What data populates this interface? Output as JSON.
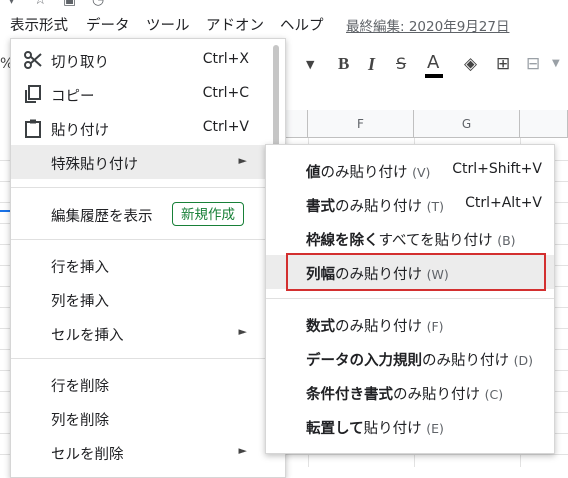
{
  "menubar": {
    "items": [
      "表示形式",
      "データ",
      "ツール",
      "アドオン",
      "ヘルプ"
    ],
    "last_edit": "最終編集: 2020年9月27日"
  },
  "toolbar": {
    "percent": "%",
    "bold": "B",
    "italic": "I",
    "strike": "S",
    "text_color": "A"
  },
  "grid": {
    "columns": [
      "F",
      "G"
    ]
  },
  "context_menu": {
    "cut": {
      "label": "切り取り",
      "shortcut": "Ctrl+X"
    },
    "copy": {
      "label": "コピー",
      "shortcut": "Ctrl+C"
    },
    "paste": {
      "label": "貼り付け",
      "shortcut": "Ctrl+V"
    },
    "paste_special": {
      "label": "特殊貼り付け",
      "arrow": "►"
    },
    "edit_history": {
      "label": "編集履歴を表示",
      "badge": "新規作成"
    },
    "insert_row": {
      "label": "行を挿入"
    },
    "insert_column": {
      "label": "列を挿入"
    },
    "insert_cells": {
      "label": "セルを挿入",
      "arrow": "►"
    },
    "delete_row": {
      "label": "行を削除"
    },
    "delete_column": {
      "label": "列を削除"
    },
    "delete_cells": {
      "label": "セルを削除",
      "arrow": "►"
    }
  },
  "paste_special_menu": {
    "values_only": {
      "bold": "値",
      "rest": "のみ貼り付け",
      "accel": "(V)",
      "shortcut": "Ctrl+Shift+V"
    },
    "format_only": {
      "bold": "書式",
      "rest": "のみ貼り付け",
      "accel": "(T)",
      "shortcut": "Ctrl+Alt+V"
    },
    "no_borders": {
      "bold": "枠線を除く",
      "rest": "すべてを貼り付け",
      "accel": "(B)"
    },
    "column_width": {
      "bold": "列幅",
      "rest": "のみ貼り付け",
      "accel": "(W)"
    },
    "formula_only": {
      "bold": "数式",
      "rest": "のみ貼り付け",
      "accel": "(F)"
    },
    "data_validation": {
      "bold": "データの入力規則",
      "rest": "のみ貼り付け",
      "accel": "(D)"
    },
    "conditional_format": {
      "bold": "条件付き書式",
      "rest": "のみ貼り付け",
      "accel": "(C)"
    },
    "transpose": {
      "bold": "転置して",
      "rest": "貼り付け",
      "accel": "(E)"
    }
  },
  "colors": {
    "highlight": "#ececec",
    "badge_green": "#188038",
    "annotation_red": "#d32f2f",
    "selection_blue": "#1a73e8"
  }
}
